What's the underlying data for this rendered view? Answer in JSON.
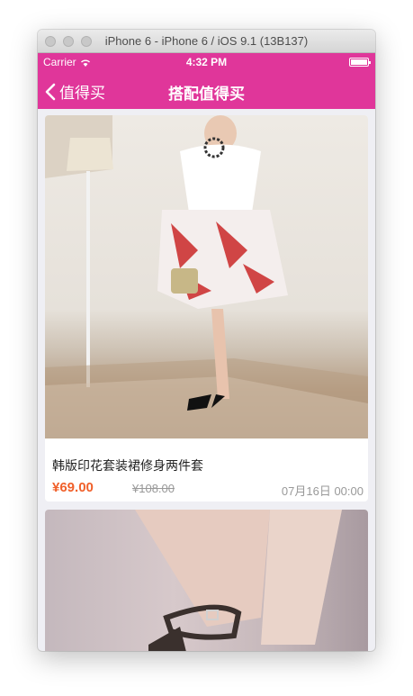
{
  "window": {
    "title": "iPhone 6 - iPhone 6 / iOS 9.1 (13B137)"
  },
  "statusbar": {
    "carrier": "Carrier",
    "time": "4:32 PM",
    "battery_level": 1.0
  },
  "navbar": {
    "back_label": "值得买",
    "title": "搭配值得买"
  },
  "items": [
    {
      "title": "韩版印花套装裙修身两件套",
      "price": "¥69.00",
      "original_price": "¥108.00",
      "date": "07月16日 00:00"
    }
  ],
  "colors": {
    "accent": "#e0369a",
    "price": "#f0602a"
  }
}
